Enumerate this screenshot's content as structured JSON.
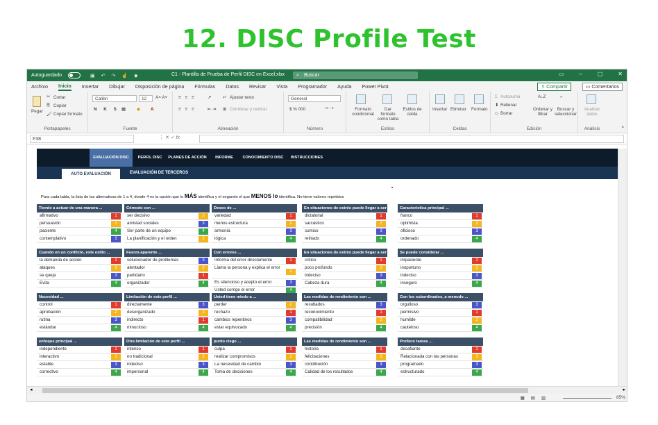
{
  "page_title": "12. DISC Profile Test",
  "colors": {
    "brand_green": "#217346",
    "title_green": "#2fc22f",
    "nav_dark": "#0d1b2a",
    "header_slate": "#3b4f67",
    "num1": "#e03b2e",
    "num2": "#f5b51d",
    "num3": "#4a55c8",
    "num4": "#3aa84a"
  },
  "titlebar": {
    "autosave": "Autoguardado",
    "file": "C1 - Plantilla de Prueba de Perfil DISC en Excel.xlsx",
    "search": "Buscar"
  },
  "menu": [
    "Archivo",
    "Inicio",
    "Insertar",
    "Dibujar",
    "Disposición de página",
    "Fórmulas",
    "Datos",
    "Revisar",
    "Vista",
    "Programador",
    "Ayuda",
    "Power Pivot"
  ],
  "menu_active": "Inicio",
  "share": "Compartir",
  "comments": "Comentarios",
  "ribbon": {
    "clipboard": {
      "paste": "Pegar",
      "cut": "Cortar",
      "copy": "Copiar",
      "format": "Copiar formato",
      "label": "Portapapeles"
    },
    "font": {
      "name": "Calibri",
      "size": "12",
      "label": "Fuente"
    },
    "align": {
      "wrap": "Ajustar texto",
      "merge": "Combinar y centrar",
      "label": "Alineación"
    },
    "number": {
      "format": "General",
      "label": "Número"
    },
    "styles": {
      "cond": "Formato condicional",
      "table": "Dar formato como tabla",
      "cell": "Estilos de celda",
      "label": "Estilos"
    },
    "cells": {
      "insert": "Insertar",
      "delete": "Eliminar",
      "format": "Formato",
      "label": "Celdas"
    },
    "editing": {
      "autosum": "Autosuma",
      "fill": "Rellenar",
      "clear": "Borrar",
      "sort": "Ordenar y filtrar",
      "find": "Buscar y seleccionar",
      "label": "Edición"
    },
    "analysis": {
      "analyze": "Analizar datos",
      "label": "Análisis"
    }
  },
  "namebox": "F38",
  "nav_tabs": [
    "EVALUACIÓN DISC",
    "PERFIL DISC",
    "PLANES DE ACCIÓN",
    "INFORME",
    "CONOCIMIENTO DISC",
    "INSTRUCCIONES"
  ],
  "sub_tabs": [
    "AUTO EVALUACIÓN",
    "EVALUACIÓN DE TERCEROS"
  ],
  "instruction": {
    "part1": "Para cada tabla, la lista de las alternativas de 1 a 4, donde 4 es la opción que lo",
    "mas": "MÁS",
    "part2": "identifica y el segundo el que",
    "menos": "MENOS lo",
    "part3": "identifica. No tiene valores repetidos"
  },
  "blocks": [
    {
      "title": "Tiende a actuar de una manera ...",
      "items": [
        [
          "afirmativo",
          "1"
        ],
        [
          "persuasión",
          "2"
        ],
        [
          "paciente",
          "4"
        ],
        [
          "contemplativo",
          "3"
        ]
      ]
    },
    {
      "title": "Cómodo con ...",
      "items": [
        [
          "ser decisivo",
          "2"
        ],
        [
          "amistad sociales",
          "3"
        ],
        [
          "Ser parte de un equipo",
          "4"
        ],
        [
          "La planificación y el orden",
          "2"
        ]
      ]
    },
    {
      "title": "Deseo de ...",
      "items": [
        [
          "variedad",
          "1"
        ],
        [
          "menos estructura",
          "2"
        ],
        [
          "armonía",
          "3"
        ],
        [
          "lógica",
          "4"
        ]
      ]
    },
    {
      "title": "En situaciones de estrés puede llegar a ser ...",
      "items": [
        [
          "dictatorial",
          "1"
        ],
        [
          "sarcástico",
          "2"
        ],
        [
          "sumiso",
          "3"
        ],
        [
          "retirado",
          "4"
        ]
      ]
    },
    {
      "title": "Característica principal ...",
      "items": [
        [
          "franco",
          "1"
        ],
        [
          "optimista",
          "2"
        ],
        [
          "oficioso",
          "3"
        ],
        [
          "ordenado",
          "4"
        ]
      ]
    },
    {
      "title": "Cuando en un conflicto, este estilo ...",
      "items": [
        [
          "la demanda de acción",
          "1"
        ],
        [
          "ataques",
          "2"
        ],
        [
          "se queja",
          "3"
        ],
        [
          "Evita",
          "4"
        ]
      ]
    },
    {
      "title": "Fuerza aparente ...",
      "items": [
        [
          "solucionador de problemas",
          "3"
        ],
        [
          "alentador",
          "2"
        ],
        [
          "partidario",
          "1"
        ],
        [
          "organizador",
          "4"
        ]
      ]
    },
    {
      "title": "Con errores ...",
      "items": [
        [
          "Informa del error directamente",
          "1"
        ],
        [
          "Llama la persona y explica el error",
          "2"
        ],
        [
          "Es silencioso y acepto el error",
          "3"
        ],
        [
          "Usted corrige el error",
          "4"
        ]
      ]
    },
    {
      "title": "En situaciones de estrés puede llegar a ser ...",
      "items": [
        [
          "crítico",
          "1"
        ],
        [
          "poco profundo",
          "2"
        ],
        [
          "indeciso",
          "3"
        ],
        [
          "Cabeza dura",
          "4"
        ]
      ]
    },
    {
      "title": "Se puede considerar ...",
      "items": [
        [
          "impaciente",
          "1"
        ],
        [
          "inoportuno",
          "2"
        ],
        [
          "indeciso",
          "3"
        ],
        [
          "inseguro",
          "4"
        ]
      ]
    },
    {
      "title": "Necesidad ...",
      "items": [
        [
          "control",
          "1"
        ],
        [
          "aprobación",
          "2"
        ],
        [
          "rutina",
          "3"
        ],
        [
          "estándar",
          "4"
        ]
      ]
    },
    {
      "title": "Limitación de este perfil ...",
      "items": [
        [
          "directamente",
          "3"
        ],
        [
          "desorganizado",
          "2"
        ],
        [
          "indirecto",
          "1"
        ],
        [
          "minucioso",
          "4"
        ]
      ]
    },
    {
      "title": "Usted tiene miedo a ...",
      "items": [
        [
          "perder",
          "2"
        ],
        [
          "rechazo",
          "1"
        ],
        [
          "cambios repentinos",
          "3"
        ],
        [
          "estar equivocado",
          "4"
        ]
      ]
    },
    {
      "title": "Las medidas de rendimiento son ...",
      "items": [
        [
          "resultados",
          "3"
        ],
        [
          "reconocimiento",
          "1"
        ],
        [
          "compatibilidad",
          "2"
        ],
        [
          "precisión",
          "4"
        ]
      ]
    },
    {
      "title": "Con los subordinados, a menudo ...",
      "items": [
        [
          "orgulloso",
          "3"
        ],
        [
          "permisivo",
          "1"
        ],
        [
          "humilde",
          "2"
        ],
        [
          "cauteloso",
          "4"
        ]
      ]
    },
    {
      "title": "enfoque principal ...",
      "items": [
        [
          "independiente",
          "1"
        ],
        [
          "interactivo",
          "2"
        ],
        [
          "estable",
          "3"
        ],
        [
          "correctivo",
          "4"
        ]
      ]
    },
    {
      "title": "Otra limitación de este perfil ...",
      "items": [
        [
          "intenso",
          "1"
        ],
        [
          "no tradicional",
          "2"
        ],
        [
          "indeciso",
          "3"
        ],
        [
          "impersonal",
          "4"
        ]
      ]
    },
    {
      "title": "punto ciego ...",
      "items": [
        [
          "culpa",
          "1"
        ],
        [
          "realizar compromisos",
          "2"
        ],
        [
          "La necesidad de cambio",
          "3"
        ],
        [
          "Toma de decisiones",
          "4"
        ]
      ]
    },
    {
      "title": "Las medidas de rendimiento son ...",
      "items": [
        [
          "historia",
          "1"
        ],
        [
          "felicitaciones",
          "2"
        ],
        [
          "contribución",
          "3"
        ],
        [
          "Calidad de los resultados",
          "4"
        ]
      ]
    },
    {
      "title": "Prefiero tareas ...",
      "items": [
        [
          "desafiante",
          "1"
        ],
        [
          "Relacionada con las personas",
          "2"
        ],
        [
          "programado",
          "3"
        ],
        [
          "estructurado",
          "4"
        ]
      ]
    }
  ],
  "zoom": "85%"
}
